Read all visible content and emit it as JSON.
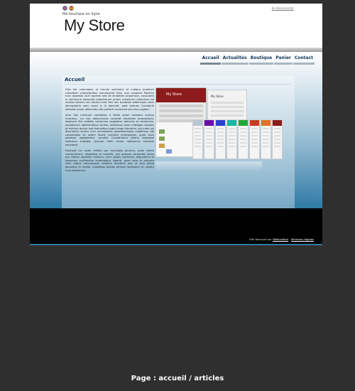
{
  "header": {
    "tagline": "Ma boutique en ligne",
    "logo": "My Store",
    "logout": "Se déconnecter",
    "flags": [
      "uk-flag-icon",
      "spain-flag-icon"
    ]
  },
  "nav": {
    "items": [
      {
        "label": "Accueil",
        "active": true
      },
      {
        "label": "Actualités",
        "active": false
      },
      {
        "label": "Boutique",
        "active": false
      },
      {
        "label": "Panier",
        "active": false
      },
      {
        "label": "Contact",
        "active": false
      }
    ]
  },
  "content": {
    "title": "Accueil",
    "paragraphs": [
      "Hinc ille commodus ut inscula pertinens et indigna praefecti custodiam protectoribus mandaverat fidis, quo conperto Montius tunc quaestor acer quidem sed ad lenitatem propensior, consulens in commune advocatis palatinarum primis scholarum adlocutus est mollius docens nec decere haec fieri nec prodesse addensque vocis obiurgatorio sonu quod si id placeret, post statuas Constantii deiectas super adimenda vita prefecti conveniet securius cogitari.",
      "Inter has ruinarum varietates a Nisibi quem tuebatur accitus Vrsicinus, cui nos obsecuturos iunxerat imperiale praeceptum, dispicere litis exitialis certamina cogebatur abnuens et reclamans, adulatorum oblatrantibus turmis, bellicosus sane milesque semper et militum ductor sed forensibus iurgiis longe discretus, qui metu sui discriminis anxius cum accusatores quaesitoresque subditivos sibi consociatos ex isdem foveis cerneret emergentes, quae clam palamve agitabantur, occultis Constantium litteris edocebat inplorans subsidia, quorum metu tumor notissimus Caesaris exhalaret.",
      "Excitavit hic ardor milites per municipia plurima, quae isdem conterminant, dispositos et castella, sed quisque serpentes latius pro viribus repellere moliens, nunc globis confertos, aliquotiens et dispersos multitudine superabatur ingenti, quae nata et educata inter editos recurvosque ambitus montium eos ut loca plana persultat et mollia, missilibus obvios eminus lacessens et ululatu truci perterrens."
    ],
    "preview_label": "My Store"
  },
  "footer": {
    "prefix": "Site fabriqué par",
    "link1": "Webcaillera",
    "sep": " - ",
    "link2": "Mentions légales"
  },
  "caption": "Page : accueil / articles",
  "colors": {
    "accent": "#15375a",
    "gradient_bottom": "#2f7aa6",
    "footer": "#000000",
    "preview_header": "#8c1c1c"
  },
  "strip_colors": [
    "#b9c7d3",
    "#6a0dad",
    "#2b3fd0",
    "#17b6a6",
    "#1fa835",
    "#cc3b1d",
    "#e0702a",
    "#8c1c1c"
  ]
}
